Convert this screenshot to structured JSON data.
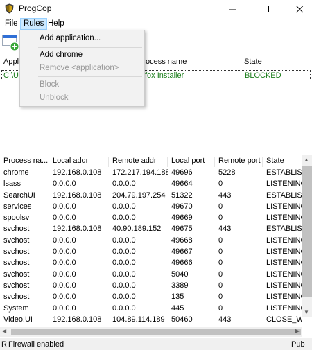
{
  "window": {
    "title": "ProgCop"
  },
  "menubar": {
    "file": "File",
    "rules": "Rules",
    "help": "Help"
  },
  "rules_menu": {
    "items": [
      {
        "label": "Add application...",
        "enabled": true
      },
      {
        "label": "Add chrome",
        "enabled": true
      },
      {
        "label": "Remove <application>",
        "enabled": false
      },
      {
        "label": "Block",
        "enabled": false
      },
      {
        "label": "Unblock",
        "enabled": false
      }
    ]
  },
  "rules_list": {
    "columns": {
      "app": "Appl",
      "process": "ocess name",
      "state": "State"
    },
    "row": {
      "path": "C:\\Us",
      "process": "fox Installer",
      "state": "BLOCKED"
    }
  },
  "connections": {
    "columns": [
      "Process na...",
      "Local addr",
      "Remote addr",
      "Local port",
      "Remote port",
      "State"
    ],
    "rows": [
      [
        "chrome",
        "192.168.0.108",
        "172.217.194.188",
        "49696",
        "5228",
        "ESTABLISHED"
      ],
      [
        "lsass",
        "0.0.0.0",
        "0.0.0.0",
        "49664",
        "0",
        "LISTENING"
      ],
      [
        "SearchUI",
        "192.168.0.108",
        "204.79.197.254",
        "51322",
        "443",
        "ESTABLISHED"
      ],
      [
        "services",
        "0.0.0.0",
        "0.0.0.0",
        "49670",
        "0",
        "LISTENING"
      ],
      [
        "spoolsv",
        "0.0.0.0",
        "0.0.0.0",
        "49669",
        "0",
        "LISTENING"
      ],
      [
        "svchost",
        "192.168.0.108",
        "40.90.189.152",
        "49675",
        "443",
        "ESTABLISHED"
      ],
      [
        "svchost",
        "0.0.0.0",
        "0.0.0.0",
        "49668",
        "0",
        "LISTENING"
      ],
      [
        "svchost",
        "0.0.0.0",
        "0.0.0.0",
        "49667",
        "0",
        "LISTENING"
      ],
      [
        "svchost",
        "0.0.0.0",
        "0.0.0.0",
        "49666",
        "0",
        "LISTENING"
      ],
      [
        "svchost",
        "0.0.0.0",
        "0.0.0.0",
        "5040",
        "0",
        "LISTENING"
      ],
      [
        "svchost",
        "0.0.0.0",
        "0.0.0.0",
        "3389",
        "0",
        "LISTENING"
      ],
      [
        "svchost",
        "0.0.0.0",
        "0.0.0.0",
        "135",
        "0",
        "LISTENING"
      ],
      [
        "System",
        "0.0.0.0",
        "0.0.0.0",
        "445",
        "0",
        "LISTENING"
      ],
      [
        "Video.UI",
        "192.168.0.108",
        "104.89.114.189",
        "50460",
        "443",
        "CLOSE_WAIT"
      ]
    ]
  },
  "statusbar": {
    "left": "R",
    "middle": "Firewall enabled",
    "right": "Pub"
  },
  "colors": {
    "blocked_green": "#1a7d1a",
    "menu_highlight": "#cce8ff"
  },
  "icons": {
    "app": "shield-icon",
    "add_app": "add-application-icon"
  }
}
